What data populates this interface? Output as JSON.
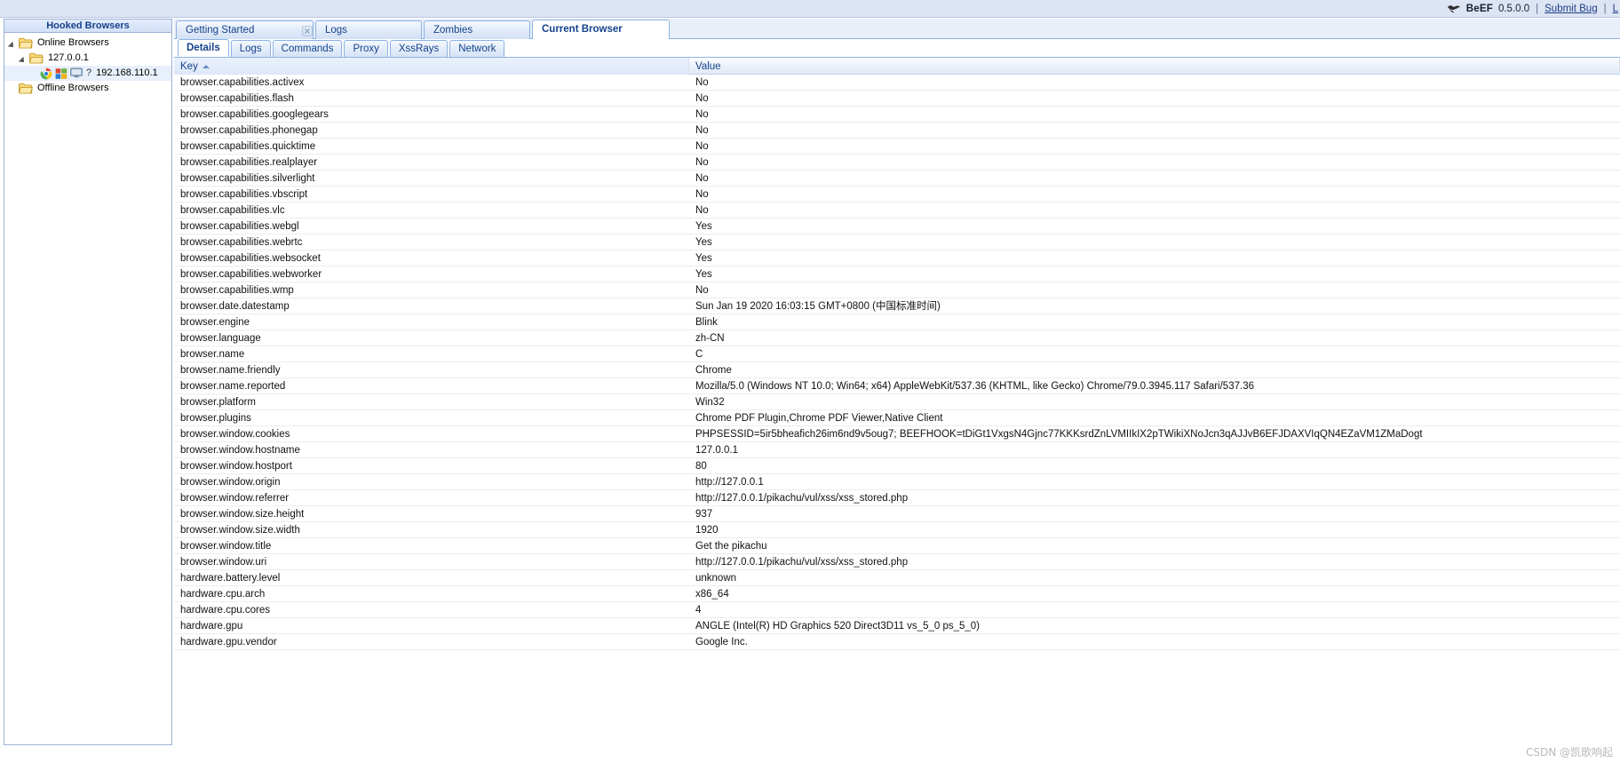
{
  "topbar": {
    "logo_icon": "bull-icon",
    "product": "BeEF",
    "version": "0.5.0.0",
    "sep": "|",
    "links": [
      {
        "label": "Submit Bug"
      },
      {
        "label": "L"
      }
    ]
  },
  "sidebar": {
    "title": "Hooked Browsers",
    "nodes": [
      {
        "label": "Online Browsers",
        "icon": "folder-icon",
        "expander": "open",
        "depth": 0,
        "selected": false
      },
      {
        "label": "127.0.0.1",
        "icon": "folder-icon",
        "expander": "open",
        "depth": 1,
        "selected": false
      },
      {
        "label": "192.168.110.1",
        "icon": "chrome-icon",
        "os_icon": "windows-icon",
        "screen_icon": "monitor-icon",
        "unknown_icon": "question-mark",
        "depth": 2,
        "selected": true
      },
      {
        "label": "Offline Browsers",
        "icon": "folder-icon",
        "expander": "none",
        "depth": 0,
        "selected": false
      }
    ]
  },
  "outer_tabs": [
    {
      "label": "Getting Started",
      "active": false,
      "closable": true
    },
    {
      "label": "Logs",
      "active": false,
      "closable": false
    },
    {
      "label": "Zombies",
      "active": false,
      "closable": false
    },
    {
      "label": "Current Browser",
      "active": true,
      "closable": false
    }
  ],
  "inner_tabs": [
    {
      "label": "Details",
      "active": true
    },
    {
      "label": "Logs",
      "active": false
    },
    {
      "label": "Commands",
      "active": false
    },
    {
      "label": "Proxy",
      "active": false
    },
    {
      "label": "XssRays",
      "active": false
    },
    {
      "label": "Network",
      "active": false
    }
  ],
  "grid": {
    "columns": [
      {
        "key": "key",
        "label": "Key",
        "sorted": "asc"
      },
      {
        "key": "value",
        "label": "Value",
        "sorted": "none"
      }
    ],
    "rows": [
      {
        "key": "browser.capabilities.activex",
        "value": "No"
      },
      {
        "key": "browser.capabilities.flash",
        "value": "No"
      },
      {
        "key": "browser.capabilities.googlegears",
        "value": "No"
      },
      {
        "key": "browser.capabilities.phonegap",
        "value": "No"
      },
      {
        "key": "browser.capabilities.quicktime",
        "value": "No"
      },
      {
        "key": "browser.capabilities.realplayer",
        "value": "No"
      },
      {
        "key": "browser.capabilities.silverlight",
        "value": "No"
      },
      {
        "key": "browser.capabilities.vbscript",
        "value": "No"
      },
      {
        "key": "browser.capabilities.vlc",
        "value": "No"
      },
      {
        "key": "browser.capabilities.webgl",
        "value": "Yes"
      },
      {
        "key": "browser.capabilities.webrtc",
        "value": "Yes"
      },
      {
        "key": "browser.capabilities.websocket",
        "value": "Yes"
      },
      {
        "key": "browser.capabilities.webworker",
        "value": "Yes"
      },
      {
        "key": "browser.capabilities.wmp",
        "value": "No"
      },
      {
        "key": "browser.date.datestamp",
        "value": "Sun Jan 19 2020 16:03:15 GMT+0800 (中国标准时间)"
      },
      {
        "key": "browser.engine",
        "value": "Blink"
      },
      {
        "key": "browser.language",
        "value": "zh-CN"
      },
      {
        "key": "browser.name",
        "value": "C"
      },
      {
        "key": "browser.name.friendly",
        "value": "Chrome"
      },
      {
        "key": "browser.name.reported",
        "value": "Mozilla/5.0 (Windows NT 10.0; Win64; x64) AppleWebKit/537.36 (KHTML, like Gecko) Chrome/79.0.3945.117 Safari/537.36"
      },
      {
        "key": "browser.platform",
        "value": "Win32"
      },
      {
        "key": "browser.plugins",
        "value": "Chrome PDF Plugin,Chrome PDF Viewer,Native Client"
      },
      {
        "key": "browser.window.cookies",
        "value": "PHPSESSID=5ir5bheafich26im6nd9v5oug7; BEEFHOOK=tDiGt1VxgsN4Gjnc77KKKsrdZnLVMIIkIX2pTWikiXNoJcn3qAJJvB6EFJDAXVIqQN4EZaVM1ZMaDogt"
      },
      {
        "key": "browser.window.hostname",
        "value": "127.0.0.1"
      },
      {
        "key": "browser.window.hostport",
        "value": "80"
      },
      {
        "key": "browser.window.origin",
        "value": "http://127.0.0.1"
      },
      {
        "key": "browser.window.referrer",
        "value": "http://127.0.0.1/pikachu/vul/xss/xss_stored.php"
      },
      {
        "key": "browser.window.size.height",
        "value": "937"
      },
      {
        "key": "browser.window.size.width",
        "value": "1920"
      },
      {
        "key": "browser.window.title",
        "value": "Get the pikachu"
      },
      {
        "key": "browser.window.uri",
        "value": "http://127.0.0.1/pikachu/vul/xss/xss_stored.php"
      },
      {
        "key": "hardware.battery.level",
        "value": "unknown"
      },
      {
        "key": "hardware.cpu.arch",
        "value": "x86_64"
      },
      {
        "key": "hardware.cpu.cores",
        "value": "4"
      },
      {
        "key": "hardware.gpu",
        "value": "ANGLE (Intel(R) HD Graphics 520 Direct3D11 vs_5_0 ps_5_0)"
      },
      {
        "key": "hardware.gpu.vendor",
        "value": "Google Inc."
      }
    ]
  },
  "watermark": "CSDN @凯歌响起"
}
